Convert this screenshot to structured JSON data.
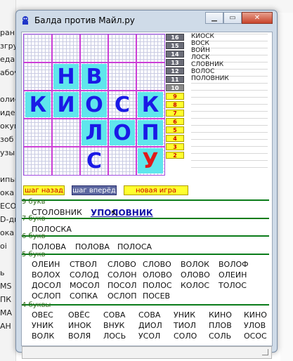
{
  "background": {
    "left_items": [
      "ран",
      "згру",
      "едак",
      "абоч",
      "",
      "олис",
      "идео",
      "окум",
      "зоб",
      "узы",
      "",
      "ипьн",
      "ока",
      "ECO",
      "D-ди",
      "ока",
      "oi",
      "",
      "ь",
      "MS",
      "ПК",
      "MA",
      "AH"
    ]
  },
  "window": {
    "title": "Балда против Майл.ру",
    "app_icon": "balda-app-icon"
  },
  "board": {
    "size": 5,
    "cells": [
      [
        "",
        "",
        "",
        "",
        ""
      ],
      [
        "",
        "Н",
        "В",
        "",
        ""
      ],
      [
        "К",
        "И",
        "О",
        "С",
        "К"
      ],
      [
        "",
        "",
        "Л",
        "О",
        "П"
      ],
      [
        "",
        "",
        "С",
        "",
        "У"
      ]
    ],
    "highlighted": [
      [
        1,
        1
      ],
      [
        1,
        2
      ],
      [
        2,
        0
      ],
      [
        2,
        1
      ],
      [
        2,
        2
      ],
      [
        2,
        4
      ],
      [
        3,
        2
      ],
      [
        3,
        3
      ],
      [
        3,
        4
      ],
      [
        4,
        4
      ]
    ],
    "plain": [
      [
        2,
        3
      ],
      [
        4,
        2
      ]
    ],
    "red": [
      [
        4,
        4
      ]
    ],
    "colors": {
      "tile": "#5fe6ec",
      "letter": "#1a1ae6",
      "new_letter": "#e01a1a",
      "grid": "#cc3fd6"
    }
  },
  "controls": {
    "back": "шаг назад",
    "forward": "шаг вперёд",
    "new_game": "новая игра"
  },
  "scores": {
    "gray": [
      "16",
      "15",
      "14",
      "13",
      "12",
      "11",
      "10"
    ],
    "yellow": [
      "9",
      "8",
      "7",
      "6",
      "5",
      "4",
      "3",
      "2"
    ]
  },
  "history": [
    "КИОСК",
    "ВОСК",
    "ВОЙН",
    "ЛОСК",
    "СЛОВНИК",
    "ВОЛОС",
    "ПОЛОВНИК"
  ],
  "groups": [
    {
      "label": "9 букв",
      "rows": [
        [
          "СТОЛОВНИК",
          "УПОЛОВНИК"
        ]
      ]
    },
    {
      "label": "7 букв",
      "rows": [
        [
          "ПОЛОСКА"
        ]
      ]
    },
    {
      "label": "6 букв",
      "rows": [
        [
          "ПОЛОВА",
          "ПОЛОВА",
          "ПОЛОСА"
        ]
      ]
    },
    {
      "label": "5 букв",
      "rows": [
        [
          "ОЛЕИН",
          "СТВОЛ",
          "СЛОВО",
          "СЛОВО",
          "ВОЛОК",
          "ВОЛОФ"
        ],
        [
          "ВОЛОХ",
          "СОЛОД",
          "СОЛОН",
          "ОЛОВО",
          "ОЛОВО",
          "ОЛЕИН"
        ],
        [
          "ДОСОЛ",
          "МОСОЛ",
          "ПОСОЛ",
          "ПОЛОС",
          "КОЛОС",
          "ТОЛОС"
        ],
        [
          "ОСЛОП",
          "СОПКА",
          "ОСЛОП",
          "ПОСЕВ"
        ]
      ]
    },
    {
      "label": "4 буквы",
      "rows": [
        [
          "ОВЕС",
          "ОВЁС",
          "СОВА",
          "СОВА",
          "УНИК",
          "КИНО",
          "КИНО"
        ],
        [
          "УНИК",
          "ИНОК",
          "ВНУК",
          "ДИОЛ",
          "ТИОЛ",
          "ПЛОВ",
          "УЛОВ"
        ],
        [
          "ВОЛК",
          "ВОЛЯ",
          "ЛОСЬ",
          "УСОЛ",
          "СОЛО",
          "СОЛЬ",
          "ОСОС"
        ]
      ]
    }
  ],
  "selected_word": "УПОЛОВНИК"
}
